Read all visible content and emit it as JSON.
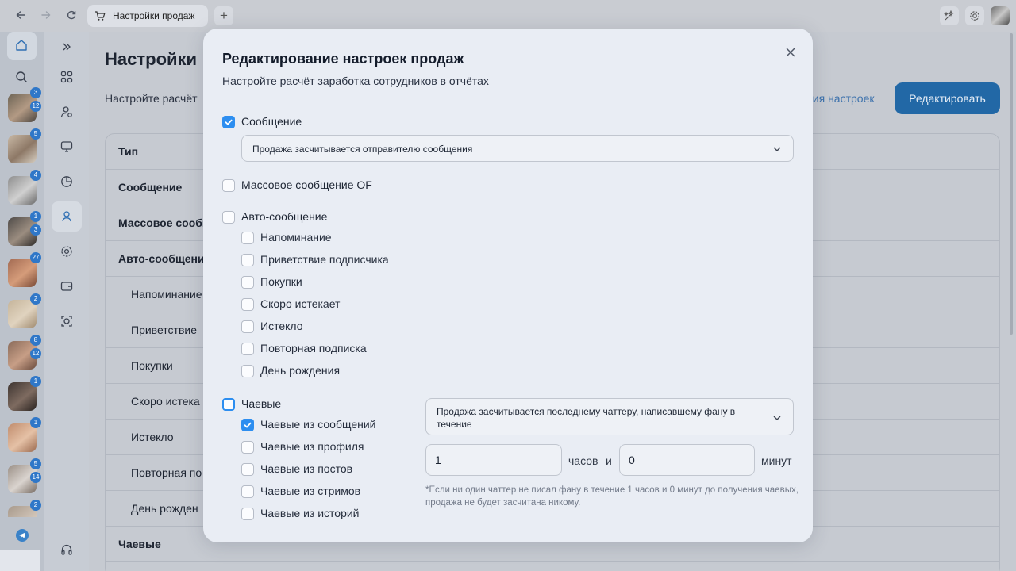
{
  "browser": {
    "tab_title": "Настройки продаж",
    "new_tab": "+"
  },
  "sidebar": {
    "badges": [
      "3",
      "12",
      "5",
      "4",
      "1",
      "3",
      "27",
      "2",
      "8",
      "12",
      "1",
      "1",
      "5",
      "14",
      "2"
    ]
  },
  "page": {
    "title": "Настройки",
    "subtitle": "Настройте расчёт",
    "history_link": "рия настроек",
    "edit_button": "Редактировать",
    "rows": [
      "Тип",
      "Сообщение",
      "Массовое сообщ",
      "Авто-сообщени",
      "Напоминание",
      "Приветствие",
      "Покупки",
      "Скоро истека",
      "Истекло",
      "Повторная по",
      "День рожден",
      "Чаевые"
    ]
  },
  "modal": {
    "title": "Редактирование настроек продаж",
    "subtitle": "Настройте расчёт заработка сотрудников в отчётах",
    "message": {
      "label": "Сообщение",
      "checked": true,
      "select_value": "Продажа засчитывается отправителю сообщения"
    },
    "mass_message": {
      "label": "Массовое сообщение OF",
      "checked": false
    },
    "auto_message": {
      "label": "Авто-сообщение",
      "checked": false,
      "items": [
        {
          "label": "Напоминание",
          "checked": false
        },
        {
          "label": "Приветствие подписчика",
          "checked": false
        },
        {
          "label": "Покупки",
          "checked": false
        },
        {
          "label": "Скоро истекает",
          "checked": false
        },
        {
          "label": "Истекло",
          "checked": false
        },
        {
          "label": "Повторная подписка",
          "checked": false
        },
        {
          "label": "День рождения",
          "checked": false
        }
      ]
    },
    "tips": {
      "label": "Чаевые",
      "checked": false,
      "items": [
        {
          "label": "Чаевые из сообщений",
          "checked": true
        },
        {
          "label": "Чаевые из профиля",
          "checked": false
        },
        {
          "label": "Чаевые из постов",
          "checked": false
        },
        {
          "label": "Чаевые из стримов",
          "checked": false
        },
        {
          "label": "Чаевые из историй",
          "checked": false
        }
      ],
      "select_value": "Продажа засчитывается последнему чаттеру, написавшему фану в течение",
      "hours_value": "1",
      "hours_unit": "часов",
      "and": "и",
      "minutes_value": "0",
      "minutes_unit": "минут",
      "note": "*Если ни один чаттер не писал фану в течение 1 часов и 0 минут до получения чаевых, продажа не будет засчитана никому."
    }
  },
  "colors": {
    "accent": "#2d8ef0",
    "overlay": "#c3c8d1",
    "modal_bg": "#e9edf4",
    "edit_button": "#2268a6"
  }
}
